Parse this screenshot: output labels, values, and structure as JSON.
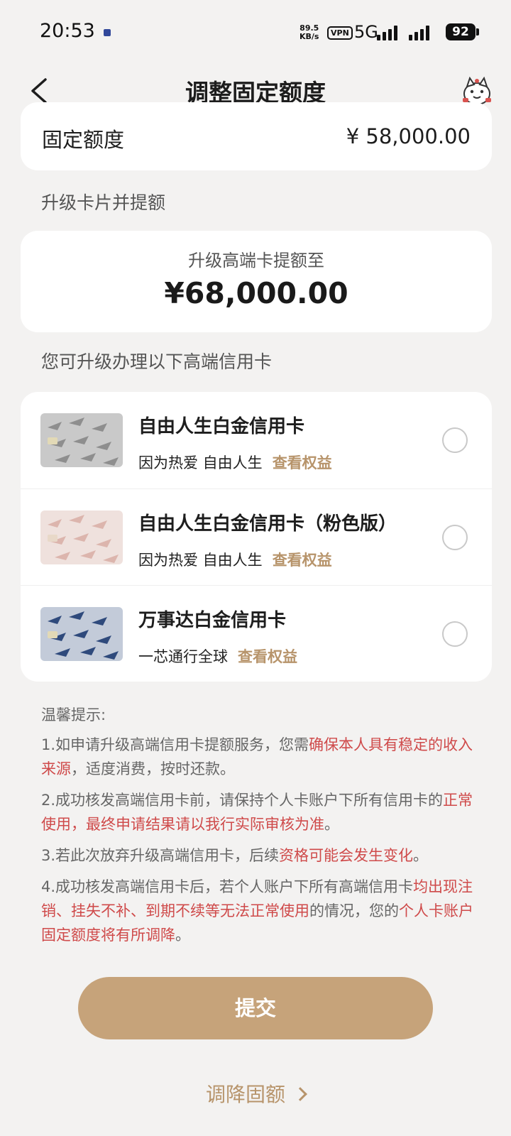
{
  "status_bar": {
    "time": "20:53",
    "speed_value": "89.5",
    "speed_unit": "KB/s",
    "vpn": "VPN",
    "network": "5G",
    "battery": "92"
  },
  "header": {
    "title": "调整固定额度",
    "back_icon": "chevron-left-icon",
    "mascot_icon": "mascot-icon"
  },
  "fixed_limit": {
    "label": "固定额度",
    "value": "¥ 58,000.00"
  },
  "upgrade_section": {
    "label": "升级卡片并提额",
    "subtitle": "升级高端卡提额至",
    "amount": "¥68,000.00"
  },
  "cards_section": {
    "label": "您可升级办理以下高端信用卡",
    "cards": [
      {
        "name": "自由人生白金信用卡",
        "slogan": "因为热爱 自由人生",
        "link": "查看权益",
        "selected": false
      },
      {
        "name": "自由人生白金信用卡（粉色版）",
        "slogan": "因为热爱 自由人生",
        "link": "查看权益",
        "selected": false
      },
      {
        "name": "万事达白金信用卡",
        "slogan": "一芯通行全球",
        "link": "查看权益",
        "selected": false
      }
    ]
  },
  "tips": {
    "title": "温馨提示:",
    "items": [
      {
        "parts": [
          "1.如申请升级高端信用卡提额服务，您需",
          "确保本人具有稳定的收入来源",
          "，适度消费，按时还款。"
        ]
      },
      {
        "parts": [
          "2.成功核发高端信用卡前，请保持个人卡账户下所有信用卡的",
          "正常使用，最终申请结果请以我行实际审核为准",
          "。"
        ]
      },
      {
        "parts": [
          "3.若此次放弃升级高端信用卡，后续",
          "资格可能会发生变化",
          "。"
        ]
      },
      {
        "parts": [
          "4.成功核发高端信用卡后，若个人账户下所有高端信用卡",
          "均出现注销、挂失不补、到期不续等无法正常使用",
          "的情况，您的",
          "个人卡账户固定额度将有所调降",
          "。"
        ]
      }
    ]
  },
  "submit_label": "提交",
  "lower_link_label": "调降固额",
  "colors": {
    "accent": "#c6a37a",
    "link": "#b7946b",
    "warning": "#cf4a4a",
    "background": "#f3f2f1"
  }
}
